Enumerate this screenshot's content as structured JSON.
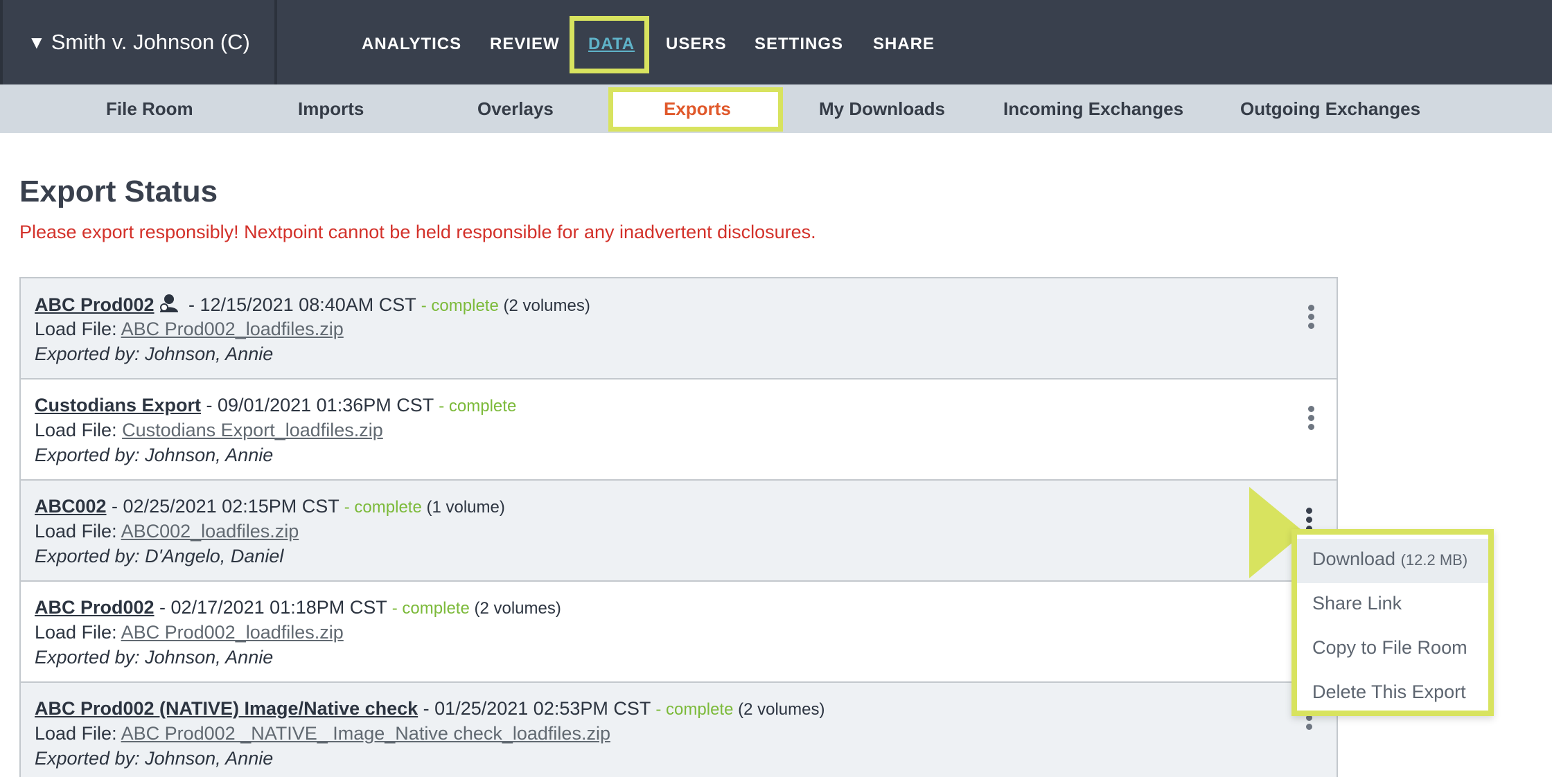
{
  "case": {
    "arrow": "▼",
    "title": "Smith v. Johnson (C)"
  },
  "nav": {
    "items": [
      {
        "label": "ANALYTICS"
      },
      {
        "label": "REVIEW"
      },
      {
        "label": "DATA"
      },
      {
        "label": "USERS"
      },
      {
        "label": "SETTINGS"
      },
      {
        "label": "SHARE"
      }
    ],
    "active": "DATA"
  },
  "subnav": {
    "items": [
      {
        "label": "File Room"
      },
      {
        "label": "Imports"
      },
      {
        "label": "Overlays"
      },
      {
        "label": "Exports"
      },
      {
        "label": "My Downloads"
      },
      {
        "label": "Incoming Exchanges"
      },
      {
        "label": "Outgoing Exchanges"
      }
    ],
    "active": "Exports"
  },
  "page": {
    "title": "Export Status",
    "warning": "Please export responsibly! Nextpoint cannot be held responsible for any inadvertent disclosures."
  },
  "exports": [
    {
      "name": "ABC Prod002",
      "has_person_icon": true,
      "datetime": " - 12/15/2021 08:40AM CST ",
      "status": "- complete",
      "volumes": " (2 volumes)",
      "load_label": "Load File: ",
      "load_file": "ABC Prod002_loadfiles.zip",
      "exported_by": "Exported by: Johnson, Annie"
    },
    {
      "name": "Custodians Export",
      "has_person_icon": false,
      "datetime": " - 09/01/2021 01:36PM CST ",
      "status": "- complete",
      "volumes": "",
      "load_label": "Load File: ",
      "load_file": "Custodians Export_loadfiles.zip",
      "exported_by": "Exported by: Johnson, Annie"
    },
    {
      "name": "ABC002",
      "has_person_icon": false,
      "datetime": " - 02/25/2021 02:15PM CST ",
      "status": "- complete",
      "volumes": " (1 volume)",
      "load_label": "Load File: ",
      "load_file": "ABC002_loadfiles.zip",
      "exported_by": "Exported by: D'Angelo, Daniel"
    },
    {
      "name": "ABC Prod002",
      "has_person_icon": false,
      "datetime": " - 02/17/2021 01:18PM CST ",
      "status": "- complete",
      "volumes": " (2 volumes)",
      "load_label": "Load File: ",
      "load_file": "ABC Prod002_loadfiles.zip",
      "exported_by": "Exported by: Johnson, Annie"
    },
    {
      "name": "ABC Prod002 (NATIVE) Image/Native check",
      "has_person_icon": false,
      "datetime": " - 01/25/2021 02:53PM CST ",
      "status": "- complete",
      "volumes": " (2 volumes)",
      "load_label": "Load File: ",
      "load_file": "ABC Prod002 _NATIVE_ Image_Native check_loadfiles.zip",
      "exported_by": "Exported by: Johnson, Annie"
    }
  ],
  "menu": {
    "download": "Download",
    "download_size": "(12.2 MB)",
    "share_link": "Share Link",
    "copy": "Copy to File Room",
    "delete": "Delete This Export"
  },
  "colors": {
    "topbar": "#39404d",
    "highlight": "#d8e35f",
    "active_tab": "#e0582a",
    "warning": "#d3312a",
    "status": "#7cba3a"
  },
  "icons": {
    "kebab": "kebab-menu-icon",
    "person": "person-icon",
    "arrow": "pointer-arrow"
  }
}
